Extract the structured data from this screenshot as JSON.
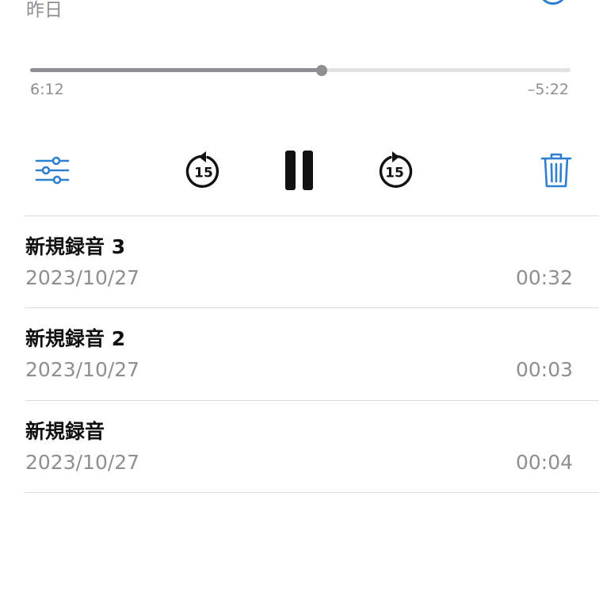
{
  "header": {
    "date_label": "昨日"
  },
  "player": {
    "progress": 0.54,
    "elapsed": "6:12",
    "remaining": "–5:22",
    "skip_back_seconds": "15",
    "skip_forward_seconds": "15"
  },
  "recordings": [
    {
      "title": "新規録音 3",
      "date": "2023/10/27",
      "duration": "00:32"
    },
    {
      "title": "新規録音 2",
      "date": "2023/10/27",
      "duration": "00:03"
    },
    {
      "title": "新規録音",
      "date": "2023/10/27",
      "duration": "00:04"
    }
  ],
  "colors": {
    "accent": "#2f7fd0",
    "secondary_text": "#8e8e93",
    "track": "#e2e2e5"
  },
  "icons": {
    "options": "sliders-icon",
    "skip_back": "gobackward-15-icon",
    "pause": "pause-icon",
    "skip_forward": "goforward-15-icon",
    "delete": "trash-icon"
  }
}
